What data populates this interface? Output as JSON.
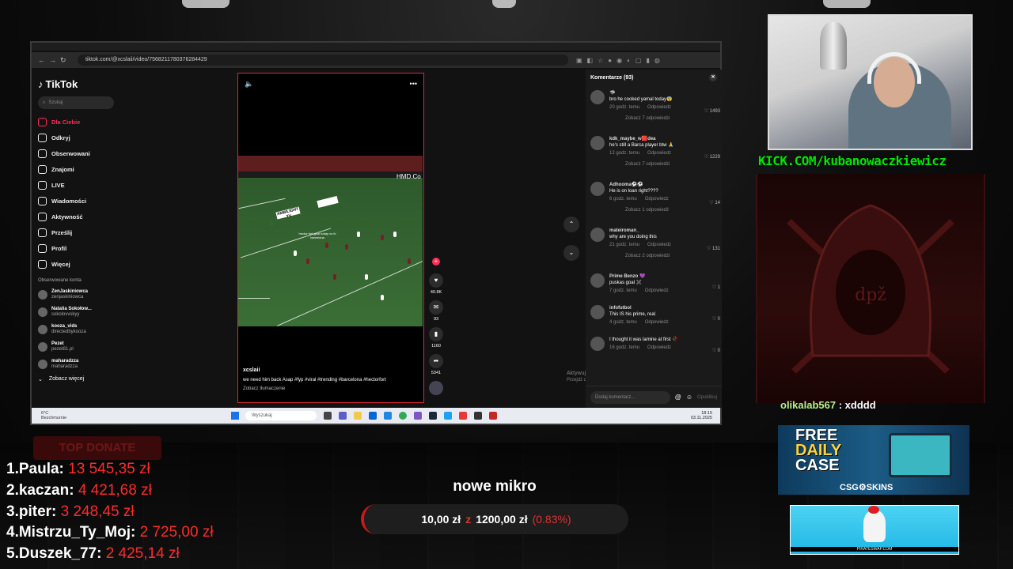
{
  "browser": {
    "url": "tiktok.com/@xcslaii/video/7568211780376284429"
  },
  "tiktok": {
    "logo": "TikTok",
    "search_placeholder": "Szukaj",
    "nav": [
      {
        "label": "Dla Ciebie",
        "icon": "home-icon"
      },
      {
        "label": "Odkryj",
        "icon": "compass-icon"
      },
      {
        "label": "Obserwowani",
        "icon": "following-icon"
      },
      {
        "label": "Znajomi",
        "icon": "friends-icon"
      },
      {
        "label": "LIVE",
        "icon": "live-icon"
      },
      {
        "label": "Wiadomości",
        "icon": "message-icon"
      },
      {
        "label": "Aktywność",
        "icon": "activity-icon"
      },
      {
        "label": "Prześlij",
        "icon": "upload-icon"
      },
      {
        "label": "Profil",
        "icon": "profile-icon"
      },
      {
        "label": "Więcej",
        "icon": "more-icon"
      }
    ],
    "followed_header": "Obserwowane konta",
    "followed": [
      {
        "name": "ZenJaskiniowca",
        "handle": "zenjaskiniowca"
      },
      {
        "name": "Natalia Sokołow...",
        "handle": "sokolovvskyy"
      },
      {
        "name": "kooza_vids",
        "handle": "directedbykooza"
      },
      {
        "name": "Pezet",
        "handle": "pezet81.pl"
      },
      {
        "name": "maharadzza",
        "handle": "maharadzza"
      }
    ],
    "see_more": "Zobacz więcej",
    "video": {
      "user": "xcslaii",
      "description": "we need him back Asap #fyp #viral #trending #barcelona #hectorfort",
      "translate": "Zobacz tłumaczenie",
      "overlay": "hector fort goal today vs fc barcelona",
      "board1": "AMBILIGHT TV",
      "board2": "HMD.Co"
    },
    "actions": {
      "likes": "40.8K",
      "comments": "93",
      "saves": "1160",
      "shares": "5341"
    },
    "comments_header": "Komentarze (93)",
    "comments": [
      {
        "user": "🦈",
        "text": "bro he cooked yamal today😨",
        "time": "20 godz. temu",
        "reply": "Odpowiedz",
        "likes": "1493",
        "more": "Zobacz 7 odpowiedzi"
      },
      {
        "user": "kdk_maybe_w🟥dea",
        "text": "he's still a Barca player btw 🙏",
        "time": "12 godz. temu",
        "reply": "Odpowiedz",
        "likes": "1229",
        "more": "Zobacz 7 odpowiedzi"
      },
      {
        "user": "Adhooma⚽⚽",
        "text": "He is on loan right????",
        "time": "6 godz. temu",
        "reply": "Odpowiedz",
        "likes": "14",
        "more": "Zobacz 1 odpowiedź"
      },
      {
        "user": "mateiroman_",
        "text": "why are you doing this",
        "time": "21 godz. temu",
        "reply": "Odpowiedz",
        "likes": "131",
        "more": "Zobacz 2 odpowiedzi"
      },
      {
        "user": "Prime Benzo 💜",
        "text": "puskas goal ✖️",
        "time": "7 godz. temu",
        "reply": "Odpowiedz",
        "likes": "1",
        "more": ""
      },
      {
        "user": "infofutbol",
        "text": "This IS his prime, real",
        "time": "4 godz. temu",
        "reply": "Odpowiedz",
        "likes": "0",
        "more": ""
      },
      {
        "user": "",
        "text": "I thought it was lamine at first 🥀",
        "time": "16 godz. temu",
        "reply": "Odpowiedz",
        "likes": "0",
        "more": ""
      }
    ],
    "comment_placeholder": "Dodaj komentarz...",
    "post_label": "Opublikuj",
    "activation_title": "Aktywuj system Windows",
    "activation_sub": "Przejdź do ustawień, aby aktywować system Windows."
  },
  "taskbar": {
    "weather_temp": "6°C",
    "weather_desc": "Bezchmurnie",
    "search": "Wyszukaj",
    "time": "18:15",
    "date": "03.11.2025"
  },
  "overlay": {
    "kick": "KICK.COM/kubanowaczkiewicz",
    "chat_user": "olikalab567",
    "chat_msg": " : xdddd",
    "ad1_line1": "FREE",
    "ad1_line2": "DAILY",
    "ad1_line3": "CASE",
    "ad1_brand": "CSG⚙SKINS",
    "ad2_brand": "PIRATESWAP.COM",
    "top_donate": "TOP DONATE",
    "donors": [
      {
        "rank": "1.",
        "name": "Paula:",
        "amount": "13 545,35 zł"
      },
      {
        "rank": "2.",
        "name": "kaczan:",
        "amount": "4 421,68 zł"
      },
      {
        "rank": "3.",
        "name": "piter:",
        "amount": "3 248,45 zł"
      },
      {
        "rank": "4.",
        "name": "Mistrzu_Ty_Moj:",
        "amount": "2 725,00 zł"
      },
      {
        "rank": "5.",
        "name": "Duszek_77:",
        "amount": "2 425,14 zł"
      }
    ],
    "goal_title": "nowe mikro",
    "goal_current": "10,00 zł",
    "goal_sep": "z",
    "goal_target": "1200,00 zł",
    "goal_pct": "(0.83%)"
  },
  "colors": {
    "tiktok_red": "#fe2c55",
    "kick_green": "#00e701",
    "donate_red": "#ff2a2a"
  }
}
